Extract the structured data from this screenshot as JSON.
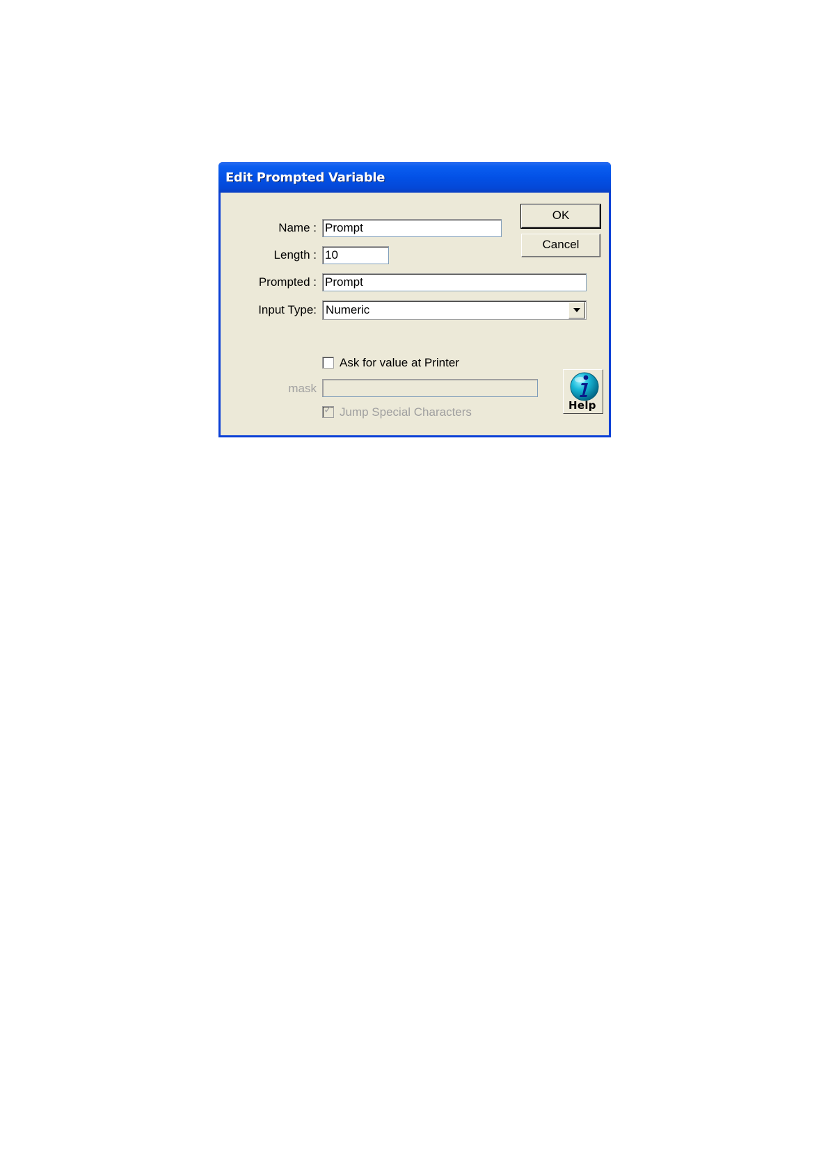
{
  "dialog": {
    "title": "Edit Prompted Variable",
    "fields": {
      "name_label": "Name :",
      "name_value": "Prompt",
      "length_label": "Length :",
      "length_value": "10",
      "prompted_label": "Prompted :",
      "prompted_value": "Prompt",
      "input_type_label": "Input Type:",
      "input_type_value": "Numeric",
      "mask_label": "mask",
      "mask_value": ""
    },
    "checkboxes": {
      "ask_printer_label": "Ask for value at Printer",
      "ask_printer_checked": false,
      "jump_special_label": "Jump Special Characters",
      "jump_special_checked": true,
      "jump_special_mark": "✓"
    },
    "buttons": {
      "ok_label": "OK",
      "cancel_label": "Cancel",
      "help_label": "Help"
    },
    "colors": {
      "titlebar": "#0351e6",
      "face": "#ece9d8",
      "disabled_text": "#a0a0a0"
    },
    "icons": {
      "help": "info-globe-icon",
      "dropdown": "chevron-down-icon"
    }
  }
}
